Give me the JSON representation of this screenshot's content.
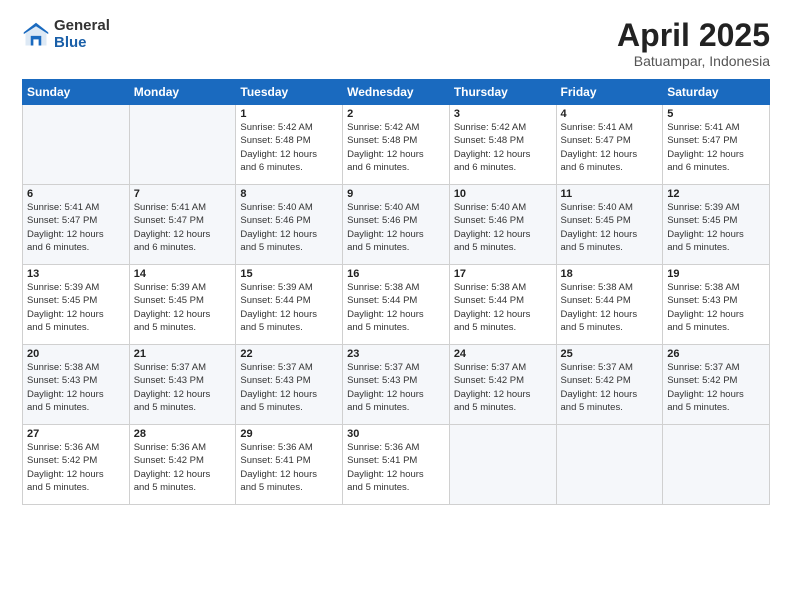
{
  "logo": {
    "general": "General",
    "blue": "Blue"
  },
  "header": {
    "month": "April 2025",
    "location": "Batuampar, Indonesia"
  },
  "weekdays": [
    "Sunday",
    "Monday",
    "Tuesday",
    "Wednesday",
    "Thursday",
    "Friday",
    "Saturday"
  ],
  "weeks": [
    [
      {
        "day": "",
        "info": ""
      },
      {
        "day": "",
        "info": ""
      },
      {
        "day": "1",
        "info": "Sunrise: 5:42 AM\nSunset: 5:48 PM\nDaylight: 12 hours\nand 6 minutes."
      },
      {
        "day": "2",
        "info": "Sunrise: 5:42 AM\nSunset: 5:48 PM\nDaylight: 12 hours\nand 6 minutes."
      },
      {
        "day": "3",
        "info": "Sunrise: 5:42 AM\nSunset: 5:48 PM\nDaylight: 12 hours\nand 6 minutes."
      },
      {
        "day": "4",
        "info": "Sunrise: 5:41 AM\nSunset: 5:47 PM\nDaylight: 12 hours\nand 6 minutes."
      },
      {
        "day": "5",
        "info": "Sunrise: 5:41 AM\nSunset: 5:47 PM\nDaylight: 12 hours\nand 6 minutes."
      }
    ],
    [
      {
        "day": "6",
        "info": "Sunrise: 5:41 AM\nSunset: 5:47 PM\nDaylight: 12 hours\nand 6 minutes."
      },
      {
        "day": "7",
        "info": "Sunrise: 5:41 AM\nSunset: 5:47 PM\nDaylight: 12 hours\nand 6 minutes."
      },
      {
        "day": "8",
        "info": "Sunrise: 5:40 AM\nSunset: 5:46 PM\nDaylight: 12 hours\nand 5 minutes."
      },
      {
        "day": "9",
        "info": "Sunrise: 5:40 AM\nSunset: 5:46 PM\nDaylight: 12 hours\nand 5 minutes."
      },
      {
        "day": "10",
        "info": "Sunrise: 5:40 AM\nSunset: 5:46 PM\nDaylight: 12 hours\nand 5 minutes."
      },
      {
        "day": "11",
        "info": "Sunrise: 5:40 AM\nSunset: 5:45 PM\nDaylight: 12 hours\nand 5 minutes."
      },
      {
        "day": "12",
        "info": "Sunrise: 5:39 AM\nSunset: 5:45 PM\nDaylight: 12 hours\nand 5 minutes."
      }
    ],
    [
      {
        "day": "13",
        "info": "Sunrise: 5:39 AM\nSunset: 5:45 PM\nDaylight: 12 hours\nand 5 minutes."
      },
      {
        "day": "14",
        "info": "Sunrise: 5:39 AM\nSunset: 5:45 PM\nDaylight: 12 hours\nand 5 minutes."
      },
      {
        "day": "15",
        "info": "Sunrise: 5:39 AM\nSunset: 5:44 PM\nDaylight: 12 hours\nand 5 minutes."
      },
      {
        "day": "16",
        "info": "Sunrise: 5:38 AM\nSunset: 5:44 PM\nDaylight: 12 hours\nand 5 minutes."
      },
      {
        "day": "17",
        "info": "Sunrise: 5:38 AM\nSunset: 5:44 PM\nDaylight: 12 hours\nand 5 minutes."
      },
      {
        "day": "18",
        "info": "Sunrise: 5:38 AM\nSunset: 5:44 PM\nDaylight: 12 hours\nand 5 minutes."
      },
      {
        "day": "19",
        "info": "Sunrise: 5:38 AM\nSunset: 5:43 PM\nDaylight: 12 hours\nand 5 minutes."
      }
    ],
    [
      {
        "day": "20",
        "info": "Sunrise: 5:38 AM\nSunset: 5:43 PM\nDaylight: 12 hours\nand 5 minutes."
      },
      {
        "day": "21",
        "info": "Sunrise: 5:37 AM\nSunset: 5:43 PM\nDaylight: 12 hours\nand 5 minutes."
      },
      {
        "day": "22",
        "info": "Sunrise: 5:37 AM\nSunset: 5:43 PM\nDaylight: 12 hours\nand 5 minutes."
      },
      {
        "day": "23",
        "info": "Sunrise: 5:37 AM\nSunset: 5:43 PM\nDaylight: 12 hours\nand 5 minutes."
      },
      {
        "day": "24",
        "info": "Sunrise: 5:37 AM\nSunset: 5:42 PM\nDaylight: 12 hours\nand 5 minutes."
      },
      {
        "day": "25",
        "info": "Sunrise: 5:37 AM\nSunset: 5:42 PM\nDaylight: 12 hours\nand 5 minutes."
      },
      {
        "day": "26",
        "info": "Sunrise: 5:37 AM\nSunset: 5:42 PM\nDaylight: 12 hours\nand 5 minutes."
      }
    ],
    [
      {
        "day": "27",
        "info": "Sunrise: 5:36 AM\nSunset: 5:42 PM\nDaylight: 12 hours\nand 5 minutes."
      },
      {
        "day": "28",
        "info": "Sunrise: 5:36 AM\nSunset: 5:42 PM\nDaylight: 12 hours\nand 5 minutes."
      },
      {
        "day": "29",
        "info": "Sunrise: 5:36 AM\nSunset: 5:41 PM\nDaylight: 12 hours\nand 5 minutes."
      },
      {
        "day": "30",
        "info": "Sunrise: 5:36 AM\nSunset: 5:41 PM\nDaylight: 12 hours\nand 5 minutes."
      },
      {
        "day": "",
        "info": ""
      },
      {
        "day": "",
        "info": ""
      },
      {
        "day": "",
        "info": ""
      }
    ]
  ]
}
